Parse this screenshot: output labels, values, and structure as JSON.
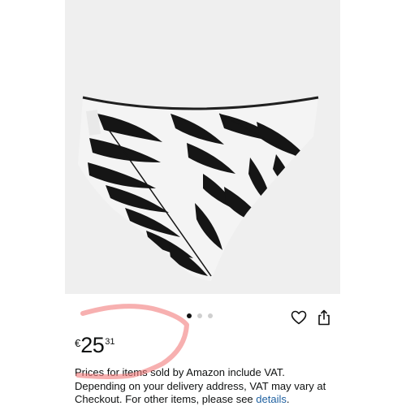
{
  "product": {
    "image_alt": "black and white palm leaf print bikini bottom",
    "carousel": {
      "total_dots": 3,
      "active_index": 0
    }
  },
  "actions": {
    "wishlist_icon": "heart-icon",
    "share_icon": "share-icon"
  },
  "price": {
    "currency_symbol": "€",
    "whole": "25",
    "fraction": "31"
  },
  "vat_note": {
    "text": "Prices for items sold by Amazon include VAT. Depending on your delivery address, VAT may vary at Checkout. For other items, please see ",
    "link_label": "details",
    "trailing": "."
  },
  "colors": {
    "link": "#2162a1",
    "text": "#0f1111",
    "image_background": "#efefef",
    "marker_annotation": "#f27c7c"
  }
}
